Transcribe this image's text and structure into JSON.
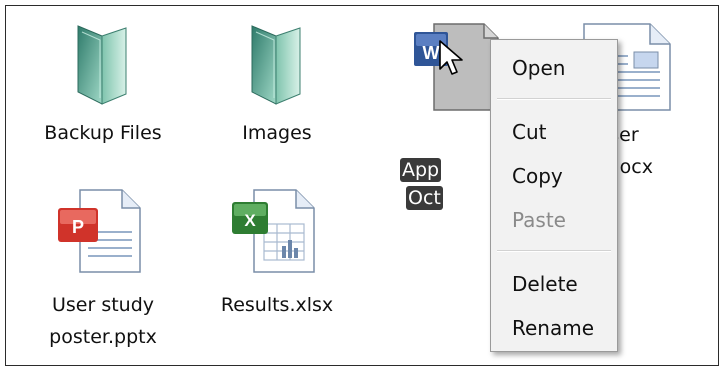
{
  "files": [
    {
      "name": "Backup Files",
      "type": "folder"
    },
    {
      "name": "Images",
      "type": "folder"
    },
    {
      "name_line1": "User study",
      "name_line2": "poster.pptx",
      "type": "pptx"
    },
    {
      "name": "Results.xlsx",
      "type": "xlsx"
    },
    {
      "name_line1": "User",
      "name_line2": "dy.docx",
      "type": "docx"
    },
    {
      "name_line1": "App",
      "name_line2": "Oct",
      "type": "word",
      "selected": true
    }
  ],
  "context_menu": {
    "items": [
      {
        "label": "Open",
        "enabled": true
      },
      {
        "label": "Cut",
        "enabled": true
      },
      {
        "label": "Copy",
        "enabled": true
      },
      {
        "label": "Paste",
        "enabled": false
      },
      {
        "label": "Delete",
        "enabled": true
      },
      {
        "label": "Rename",
        "enabled": true
      }
    ]
  },
  "colors": {
    "folder": "#4fa08a",
    "ppt_accent": "#d0332a",
    "excel_accent": "#2e7d32",
    "word_accent": "#2f5597",
    "selection": "#3a3a3a",
    "menu_bg": "#f2f2f2"
  },
  "icons": [
    "folder-icon",
    "powerpoint-file-icon",
    "excel-file-icon",
    "word-file-icon",
    "mouse-pointer-icon"
  ]
}
